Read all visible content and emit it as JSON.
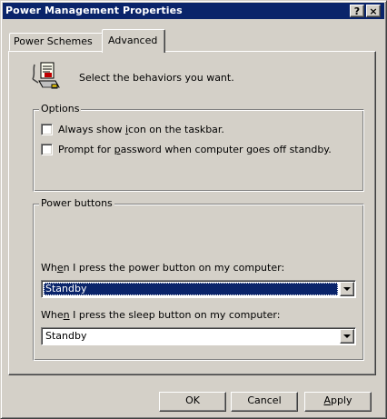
{
  "window": {
    "title": "Power Management Properties"
  },
  "titlebar_buttons": {
    "help": "?",
    "close": "×"
  },
  "tabs": [
    {
      "label": "Power Schemes",
      "active": false
    },
    {
      "label": "Advanced",
      "active": true
    }
  ],
  "intro_text": "Select the behaviors you want.",
  "options": {
    "legend": "Options",
    "checkboxes": [
      {
        "pre": "Always show ",
        "ul": "i",
        "post": "con on the taskbar.",
        "checked": false
      },
      {
        "pre": "Prompt for ",
        "ul": "p",
        "post": "assword when computer goes off standby.",
        "checked": false
      }
    ]
  },
  "power_buttons": {
    "legend": "Power buttons",
    "power_label": {
      "pre": "Wh",
      "ul": "e",
      "post": "n I press the power button on my computer:"
    },
    "power_value": "Standby",
    "sleep_label": {
      "pre": "Whe",
      "ul": "n",
      "post": " I press the sleep button on my computer:"
    },
    "sleep_value": "Standby"
  },
  "buttons": {
    "ok": "OK",
    "cancel": "Cancel",
    "apply": {
      "ul": "A",
      "post": "pply"
    }
  },
  "colors": {
    "face": "#d4d0c8",
    "title_bar": "#0a246a",
    "selection": "#0a246a"
  }
}
